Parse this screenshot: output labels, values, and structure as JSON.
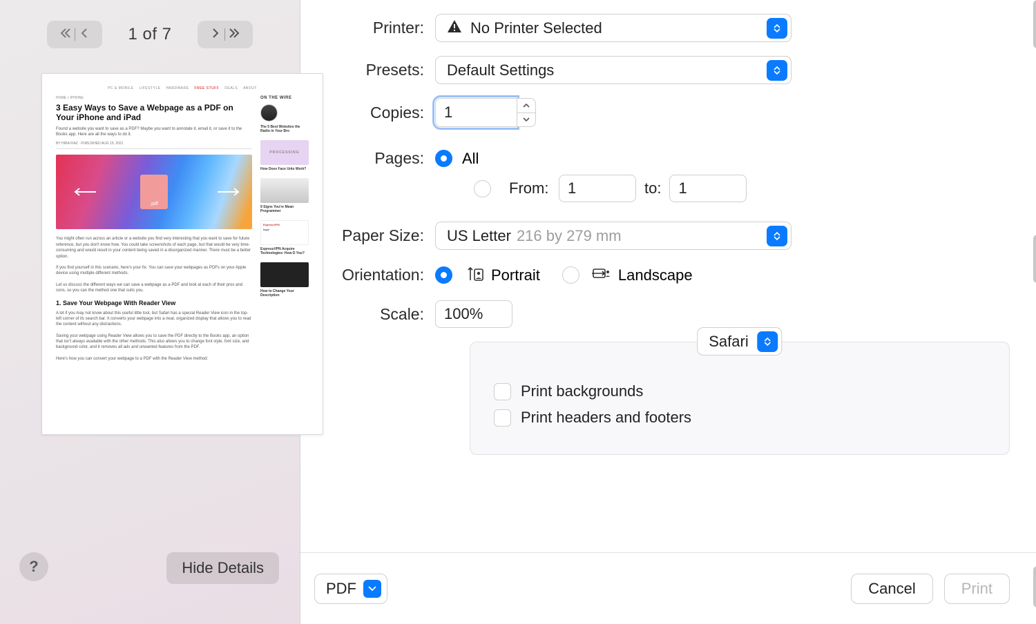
{
  "preview": {
    "page_indicator": "1 of 7",
    "hide_details_label": "Hide Details",
    "help_glyph": "?",
    "article": {
      "nav_items": [
        "PC & MOBILE",
        "LIFESTYLE",
        "HARDWARE",
        "FREE STUFF",
        "DEALS",
        "ABOUT"
      ],
      "breadcrumb": "HOME > IPHONE",
      "title": "3 Easy Ways to Save a Webpage as a PDF on Your iPhone and iPad",
      "subtitle": "Found a website you want to save as a PDF? Maybe you want to annotate it, email it, or save it to the Books app. Here are all the ways to do it.",
      "byline": "BY HIRA FIAZ · PUBLISHED AUG 15, 2021",
      "hero_badge": ".pdf",
      "para1": "You might often run across an article or a website you find very interesting that you want to save for future reference, but you don't know how. You could take screenshots of each page, but that would be very time-consuming and would result in your content being saved in a disorganized manner. There must be a better option.",
      "para2": "If you find yourself in this scenario, here's your fix. You can save your webpages as PDFs on your Apple device using multiple different methods.",
      "para3": "Let us discuss the different ways we can save a webpage as a PDF and look at each of their pros and cons, so you can the method one that suits you.",
      "h3": "1. Save Your Webpage With Reader View",
      "para4": "A lot if you may not know about this useful little tool, but Safari has a special Reader View icon in the top-left corner of its search bar. It converts your webpage into a neat, organized display that allows you to read the content without any distractions.",
      "para5": "Saving your webpage using Reader View allows you to save the PDF directly to the Books app, an option that isn't always available with the other methods. This also allows you to change font style, font size, and background color, and it removes all ads and unwanted features from the PDF.",
      "para6": "Here's how you can convert your webpage to a PDF with the Reader View method:",
      "sidebar_heading": "ON THE WIRE",
      "side_items": [
        {
          "title": "The 5 Best Websites the Radio in Your Bro"
        },
        {
          "title": "How Does Face Unlo Work?",
          "badge": "PROCESSING"
        },
        {
          "title": "9 Signs You're Mean Programmer"
        },
        {
          "title": "ExpressVPN Acquire Technologies: How D You?",
          "logos": [
            "ExpressVPN",
            "kape"
          ]
        },
        {
          "title": "How to Change Your Description"
        }
      ]
    }
  },
  "settings": {
    "printer": {
      "label": "Printer:",
      "value": "No Printer Selected"
    },
    "presets": {
      "label": "Presets:",
      "value": "Default Settings"
    },
    "copies": {
      "label": "Copies:",
      "value": "1"
    },
    "pages": {
      "label": "Pages:",
      "all_label": "All",
      "from_label": "From:",
      "to_label": "to:",
      "from_value": "1",
      "to_value": "1",
      "mode": "all"
    },
    "paper_size": {
      "label": "Paper Size:",
      "value": "US Letter",
      "dimensions": "216 by 279 mm"
    },
    "orientation": {
      "label": "Orientation:",
      "portrait_label": "Portrait",
      "landscape_label": "Landscape",
      "value": "portrait"
    },
    "scale": {
      "label": "Scale:",
      "value": "100%"
    },
    "app_section": {
      "app_name": "Safari",
      "print_backgrounds_label": "Print backgrounds",
      "print_backgrounds": false,
      "print_headers_label": "Print headers and footers",
      "print_headers": false
    }
  },
  "footer": {
    "pdf_label": "PDF",
    "cancel_label": "Cancel",
    "print_label": "Print"
  }
}
